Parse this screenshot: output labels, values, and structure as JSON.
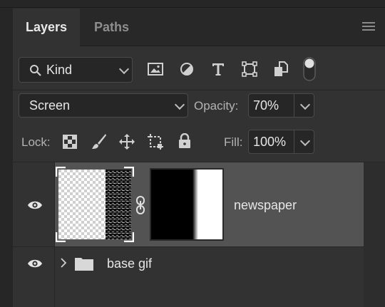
{
  "tabs": [
    {
      "label": "Layers",
      "active": true
    },
    {
      "label": "Paths",
      "active": false
    }
  ],
  "filter": {
    "kind_label": "Kind",
    "icons": [
      "image-filter-icon",
      "adjustment-filter-icon",
      "type-filter-icon",
      "shape-filter-icon",
      "smart-object-filter-icon",
      "filter-toggle-switch"
    ]
  },
  "blend": {
    "mode": "Screen",
    "opacity_label": "Opacity:",
    "opacity_value": "70%"
  },
  "lock": {
    "label": "Lock:",
    "icons": [
      "lock-transparent-pixels-icon",
      "lock-image-pixels-icon",
      "lock-position-icon",
      "lock-artboard-icon",
      "lock-all-icon"
    ],
    "fill_label": "Fill:",
    "fill_value": "100%"
  },
  "layers": [
    {
      "name": "newspaper",
      "type": "pixel-with-mask",
      "visible": true,
      "selected": true
    },
    {
      "name": "base gif",
      "type": "group",
      "visible": true,
      "selected": false,
      "expanded": false
    }
  ],
  "colors": {
    "panel": "#323232",
    "selected_row": "#535353",
    "field_bg": "#262626"
  }
}
